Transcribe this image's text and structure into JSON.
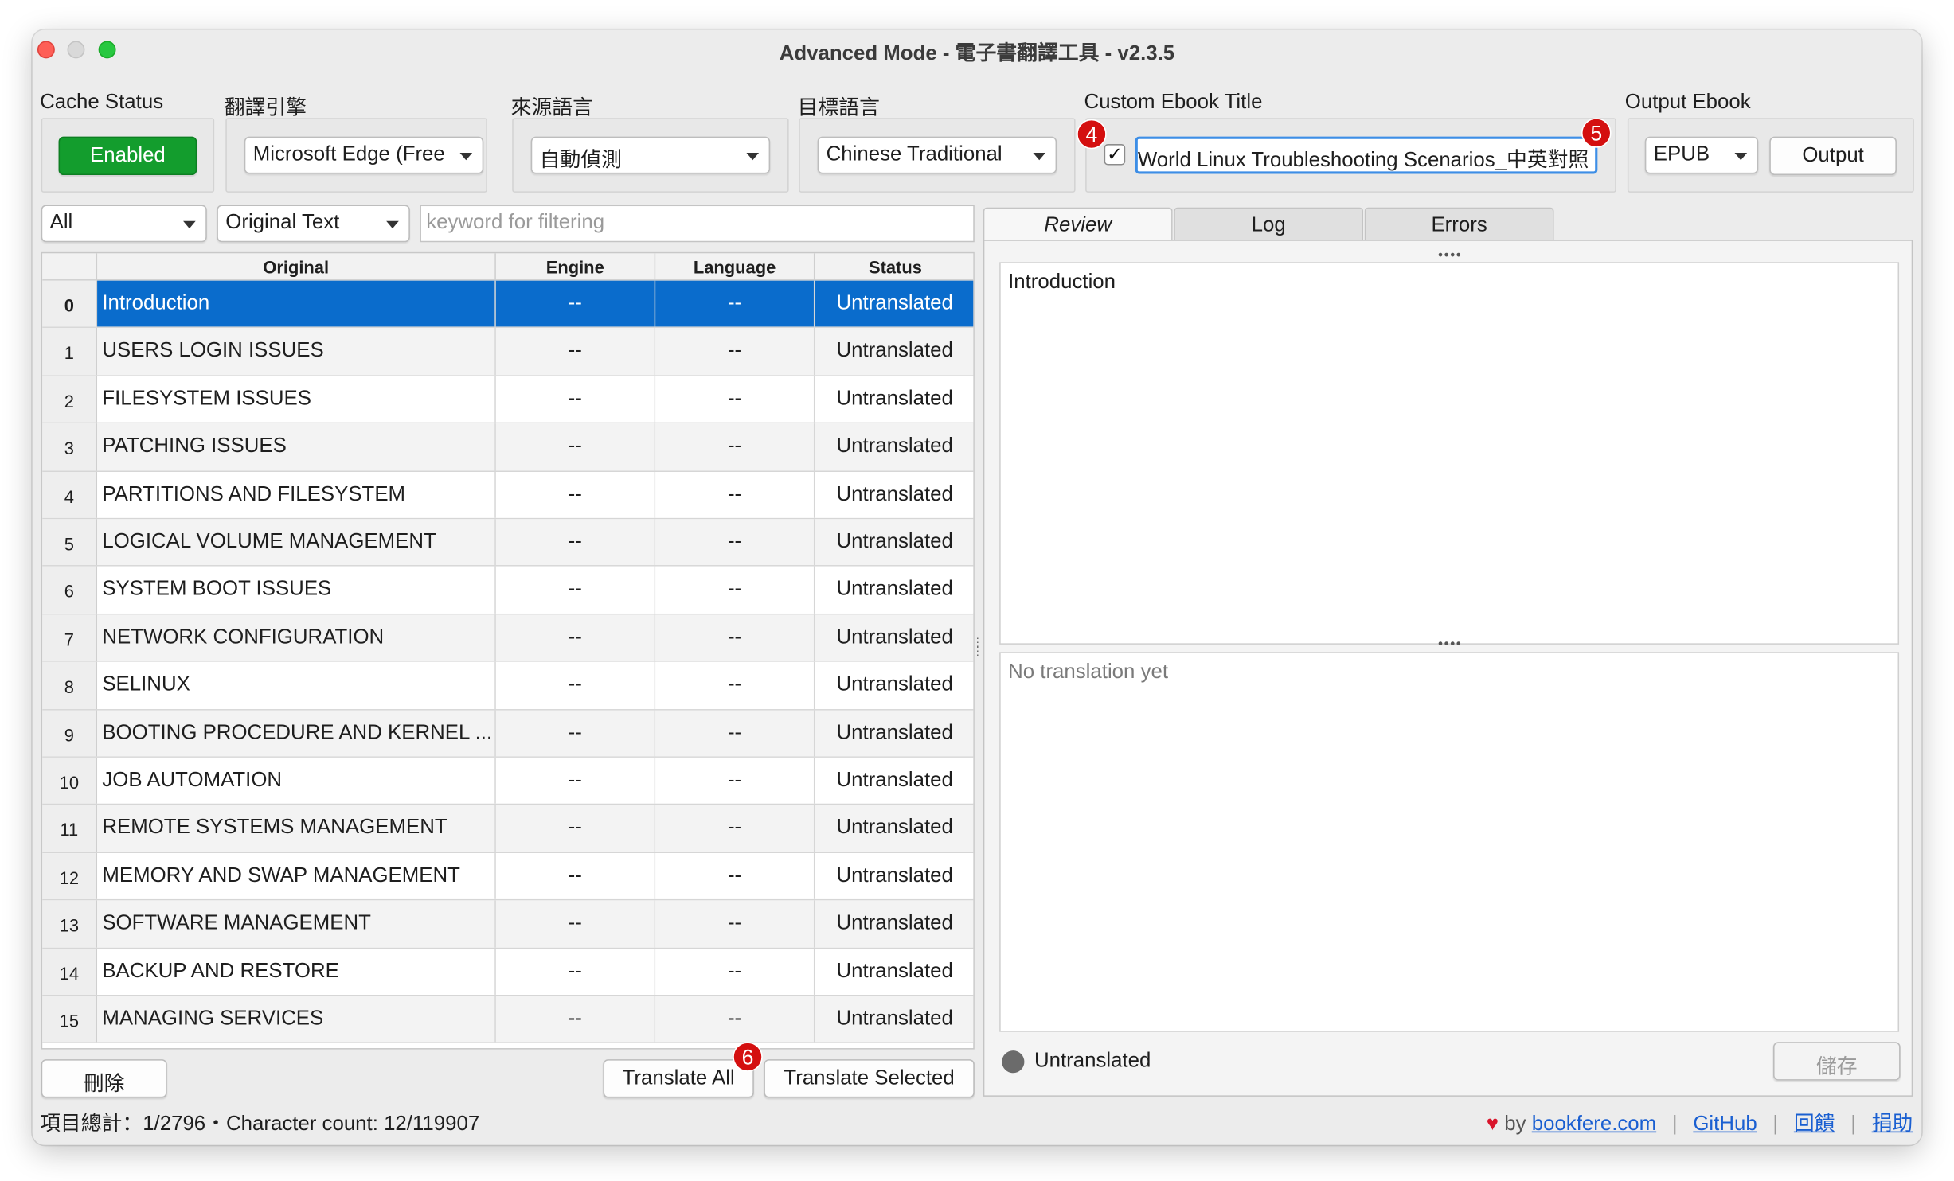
{
  "window": {
    "title": "Advanced Mode - 電子書翻譯工具 - v2.3.5"
  },
  "cache": {
    "label": "Cache Status",
    "button": "Enabled"
  },
  "engine": {
    "label": "翻譯引擎",
    "value": "Microsoft Edge (Free"
  },
  "source_lang": {
    "label": "來源語言",
    "value": "自動偵測"
  },
  "target_lang": {
    "label": "目標語言",
    "value": "Chinese Traditional"
  },
  "custom_title": {
    "label": "Custom Ebook Title",
    "checked": "✓",
    "value": "World Linux Troubleshooting Scenarios_中英對照"
  },
  "output": {
    "label": "Output Ebook",
    "format": "EPUB",
    "button": "Output"
  },
  "badges": {
    "b4": "4",
    "b5": "5",
    "b6": "6"
  },
  "filters": {
    "scope": "All",
    "field": "Original Text",
    "keyword_placeholder": "keyword for filtering"
  },
  "table": {
    "columns": [
      "Original",
      "Engine",
      "Language",
      "Status"
    ],
    "rows": [
      {
        "idx": "0",
        "original": "Introduction",
        "engine": "--",
        "language": "--",
        "status": "Untranslated"
      },
      {
        "idx": "1",
        "original": "USERS LOGIN ISSUES",
        "engine": "--",
        "language": "--",
        "status": "Untranslated"
      },
      {
        "idx": "2",
        "original": "FILESYSTEM ISSUES",
        "engine": "--",
        "language": "--",
        "status": "Untranslated"
      },
      {
        "idx": "3",
        "original": "PATCHING ISSUES",
        "engine": "--",
        "language": "--",
        "status": "Untranslated"
      },
      {
        "idx": "4",
        "original": "PARTITIONS AND FILESYSTEM",
        "engine": "--",
        "language": "--",
        "status": "Untranslated"
      },
      {
        "idx": "5",
        "original": "LOGICAL VOLUME MANAGEMENT",
        "engine": "--",
        "language": "--",
        "status": "Untranslated"
      },
      {
        "idx": "6",
        "original": "SYSTEM BOOT ISSUES",
        "engine": "--",
        "language": "--",
        "status": "Untranslated"
      },
      {
        "idx": "7",
        "original": "NETWORK CONFIGURATION",
        "engine": "--",
        "language": "--",
        "status": "Untranslated"
      },
      {
        "idx": "8",
        "original": "SELINUX",
        "engine": "--",
        "language": "--",
        "status": "Untranslated"
      },
      {
        "idx": "9",
        "original": "BOOTING PROCEDURE AND KERNEL ...",
        "engine": "--",
        "language": "--",
        "status": "Untranslated"
      },
      {
        "idx": "10",
        "original": "JOB AUTOMATION",
        "engine": "--",
        "language": "--",
        "status": "Untranslated"
      },
      {
        "idx": "11",
        "original": "REMOTE SYSTEMS MANAGEMENT",
        "engine": "--",
        "language": "--",
        "status": "Untranslated"
      },
      {
        "idx": "12",
        "original": "MEMORY AND SWAP MANAGEMENT",
        "engine": "--",
        "language": "--",
        "status": "Untranslated"
      },
      {
        "idx": "13",
        "original": "SOFTWARE MANAGEMENT",
        "engine": "--",
        "language": "--",
        "status": "Untranslated"
      },
      {
        "idx": "14",
        "original": "BACKUP AND RESTORE",
        "engine": "--",
        "language": "--",
        "status": "Untranslated"
      },
      {
        "idx": "15",
        "original": "MANAGING SERVICES",
        "engine": "--",
        "language": "--",
        "status": "Untranslated"
      }
    ]
  },
  "actions": {
    "delete": "刪除",
    "translate_all": "Translate All",
    "translate_selected": "Translate Selected"
  },
  "footer": {
    "summary": "項目總計：1/2796・Character count: 12/119907",
    "by": "by",
    "heart": "♥",
    "links": [
      "bookfere.com",
      "GitHub",
      "回饋",
      "捐助"
    ],
    "separator": "|"
  },
  "tabs": [
    "Review",
    "Log",
    "Errors"
  ],
  "review": {
    "original_text": "Introduction",
    "translation_placeholder": "No translation yet",
    "status": "Untranslated",
    "save": "儲存",
    "grip": "••••"
  },
  "colors": {
    "accent": "#0a6ccc",
    "enabled_green": "#139d2d",
    "badge_red": "#d40f0f",
    "link": "#1a5fd1"
  }
}
